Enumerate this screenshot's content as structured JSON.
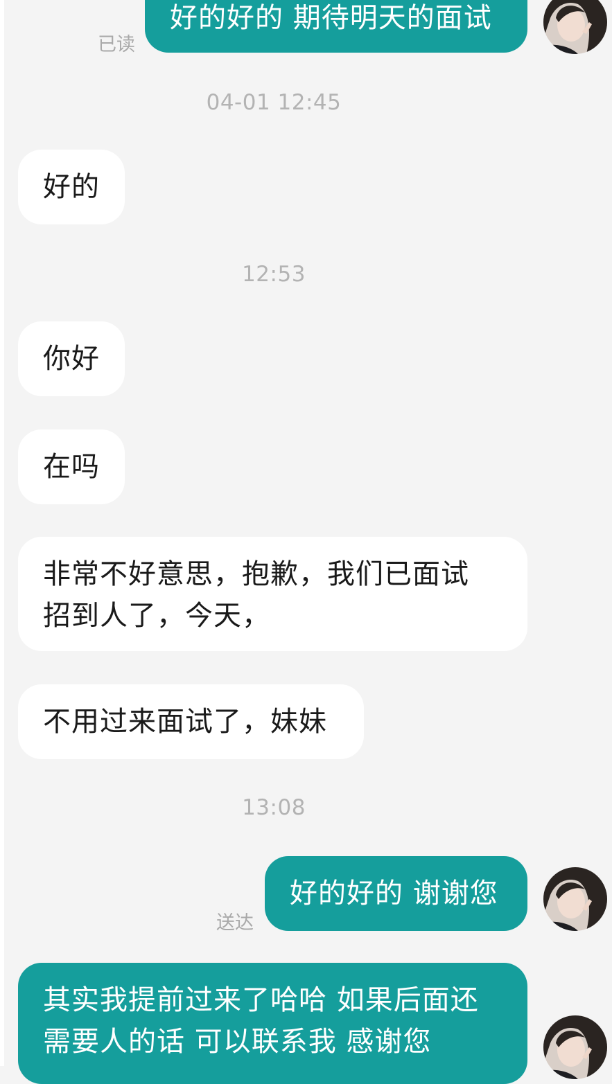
{
  "colors": {
    "background": "#f4f4f4",
    "incoming_bubble": "#ffffff",
    "outgoing_bubble": "#159e9c",
    "timestamp": "#b3b3b3"
  },
  "messages": [
    {
      "direction": "outgoing",
      "text": "好的好的 期待明天的面试",
      "status": "已读"
    },
    {
      "type": "timestamp",
      "text": "04-01 12:45"
    },
    {
      "direction": "incoming",
      "text": "好的"
    },
    {
      "type": "timestamp",
      "text": "12:53"
    },
    {
      "direction": "incoming",
      "text": "你好"
    },
    {
      "direction": "incoming",
      "text": "在吗"
    },
    {
      "direction": "incoming",
      "lines": [
        "非常不好意思，抱歉，我们已面试",
        "招到人了，今天，"
      ]
    },
    {
      "direction": "incoming",
      "text": "不用过来面试了，妹妹"
    },
    {
      "type": "timestamp",
      "text": "13:08"
    },
    {
      "direction": "outgoing",
      "text": "好的好的 谢谢您",
      "status": "送达"
    },
    {
      "direction": "outgoing",
      "lines": [
        "其实我提前过来了哈哈 如果后面还",
        "需要人的话 可以联系我 感谢您"
      ]
    }
  ],
  "avatar_icon": "user-photo-avatar"
}
